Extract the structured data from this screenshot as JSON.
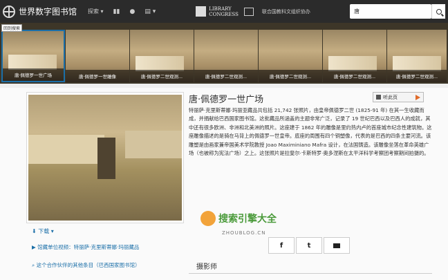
{
  "header": {
    "site_title": "世界数字图书馆",
    "nav_explore": "探索",
    "loc_line1": "LIBRARY",
    "loc_line2": "OF",
    "loc_line3": "CONGRESS",
    "partner_label": "联合国教科文组织协办",
    "search_value": "唐"
  },
  "strip": {
    "back_label": "回到搜索",
    "items": [
      {
        "caption": "唐·佩德罗一世广场"
      },
      {
        "caption": "唐·佩德罗一世雕像"
      },
      {
        "caption": "唐·佩德罗二世观测..."
      },
      {
        "caption": "唐·佩德罗二世观测..."
      },
      {
        "caption": "唐·佩德罗二世观测..."
      },
      {
        "caption": "唐·佩德罗二世观测..."
      },
      {
        "caption": "唐·佩德罗二世观测..."
      }
    ]
  },
  "item": {
    "title": "唐·佩德罗一世广场",
    "listen_label": "听此页",
    "description": "特丽萨·克里斯蒂娜·玛丽亚藏品共包括 21,742 张照片，由皇帝佩德罗二世 (1825-91 年) 在其一生收藏而成，并捐献给巴西国家图书馆。这批藏品所涵盖的主题非常广泛，记录了 19 世纪巴西以及巴西人的成就，其中还有很多欧洲、非洲和北美洲的照片。这座建于 1862 年的雕像是里约热内卢的首座城市纪念性建筑物。这座雕像描述的是骑在马背上的佩德罗一世皇帝。底座的周围有四个铜塑像，代表的是巴西的四条主要河流。该雕塑是由画家兼帝国美术学院教授 Joao Maximiniano Mafra 设计，在法国铸造。该雕像坐落在革命英雄广场（也被称为宪法广场）之上。这张照片是拉斐尔·卡斯特罗·奥多涅斯在太平洋科学考察团考察期间拍摄的。",
    "download_label": "下载",
    "video_link": "馆藏单位视频：特丽萨·克里斯蒂娜·玛丽藏品",
    "more_link": "这个合作伙伴的其他条目（巴西国家图书馆）",
    "photographer_heading": "摄影师"
  },
  "watermark": {
    "text": "搜索引擎大全",
    "url": "ZHOUBLOG.CN"
  },
  "share": {
    "facebook": "f",
    "twitter": "t"
  },
  "colors": {
    "topbar": "#2b2b2b",
    "accent": "#1b6fa8",
    "listen_play": "#e06b2a"
  }
}
